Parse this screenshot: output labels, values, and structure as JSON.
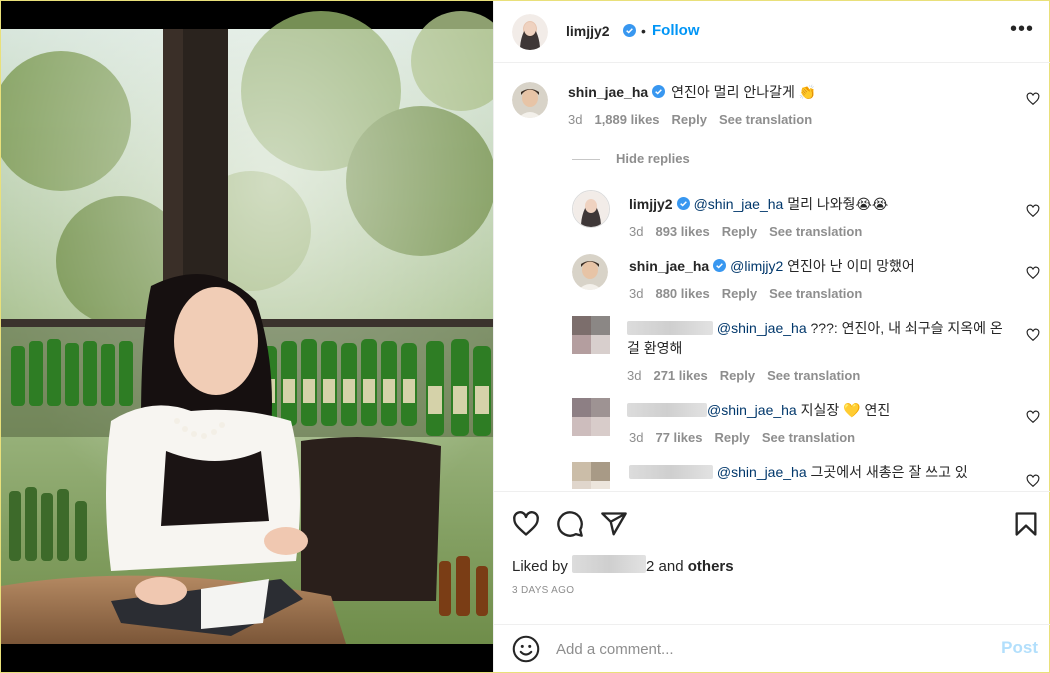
{
  "post": {
    "author": "limjjy2",
    "separator": "•",
    "follow_label": "Follow",
    "more_label": "•••"
  },
  "comments": [
    {
      "user": "shin_jae_ha",
      "verified": true,
      "text": "연진아 멀리 안나갈게 👏",
      "time": "3d",
      "likes": "1,889 likes",
      "reply": "Reply",
      "translate": "See translation"
    }
  ],
  "hide_replies": "Hide replies",
  "replies": [
    {
      "user": "limjjy2",
      "verified": true,
      "mention": "@shin_jae_ha",
      "text": "멀리 나와줭😭😭",
      "time": "3d",
      "likes": "893 likes",
      "reply": "Reply",
      "translate": "See translation"
    },
    {
      "user": "shin_jae_ha",
      "verified": true,
      "mention": "@limjjy2",
      "text": "연진아 난 이미 망했어",
      "time": "3d",
      "likes": "880 likes",
      "reply": "Reply",
      "translate": "See translation"
    },
    {
      "user_blurred_text": "chaanboo_",
      "mention": "@shin_jae_ha",
      "text": "???: 연진아, 내 쇠구슬 지옥에 온걸 환영해",
      "time": "3d",
      "likes": "271 likes",
      "reply": "Reply",
      "translate": "See translation"
    },
    {
      "mention": "@shin_jae_ha",
      "text": "지실장 💛 연진",
      "time": "3d",
      "likes": "77 likes",
      "reply": "Reply",
      "translate": "See translation"
    },
    {
      "mention": "@shin_jae_ha",
      "text": "그곳에서 새총은 잘 쓰고 있"
    }
  ],
  "actions": {
    "liked_by_prefix": "Liked by",
    "liked_by_suffix": "2 and",
    "others": "others",
    "time_ago": "3 DAYS AGO"
  },
  "add_comment": {
    "placeholder": "Add a comment...",
    "post_label": "Post"
  },
  "colors": {
    "accent": "#0095f6",
    "verified": "#3897f0",
    "post_disabled": "#b2dffc",
    "mention": "#00376b"
  },
  "icons": [
    "heart-icon",
    "comment-icon",
    "share-icon",
    "bookmark-icon",
    "emoji-icon",
    "verified-badge-icon",
    "more-options-icon"
  ]
}
